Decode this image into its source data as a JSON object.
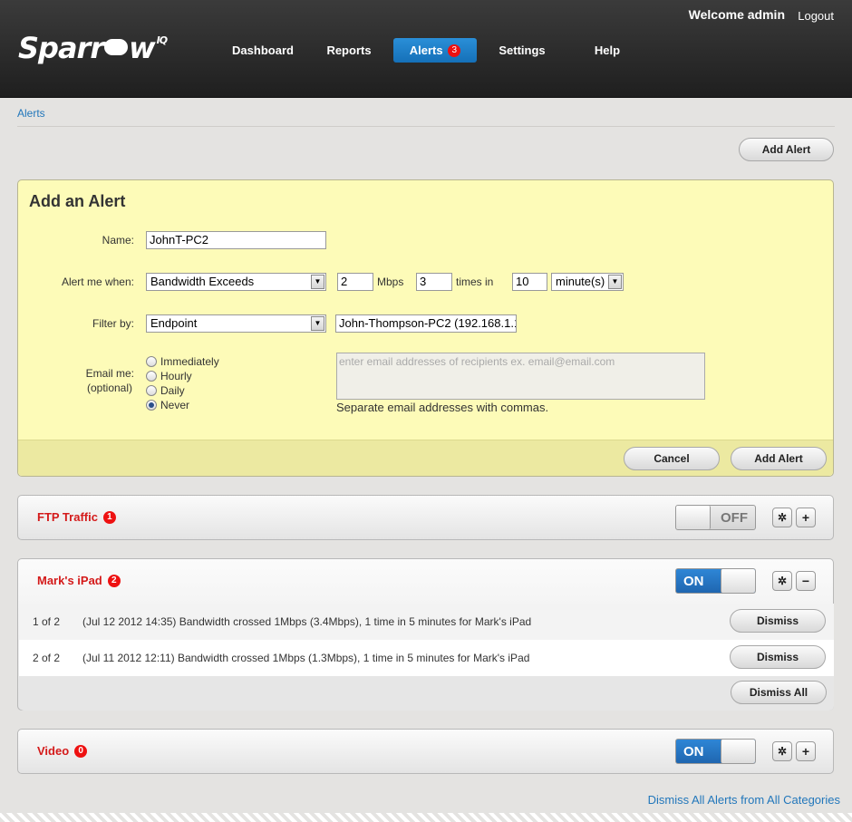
{
  "header": {
    "logo": {
      "pre": "Sparr",
      "post": "w",
      "superscript": "IQ"
    },
    "welcome": "Welcome admin",
    "logout": "Logout",
    "nav": [
      {
        "label": "Dashboard"
      },
      {
        "label": "Reports"
      },
      {
        "label": "Alerts",
        "badge": "3"
      },
      {
        "label": "Settings"
      },
      {
        "label": "Help"
      }
    ]
  },
  "breadcrumb": "Alerts",
  "top_button": "Add Alert",
  "form": {
    "title": "Add an Alert",
    "name_label": "Name:",
    "name_value": "JohnT-PC2",
    "alert_when_label": "Alert me when:",
    "condition": "Bandwidth Exceeds",
    "amount": "2",
    "unit": "Mbps",
    "times": "3",
    "times_in_label": "times in",
    "period": "10",
    "period_unit": "minute(s)",
    "filter_label": "Filter by:",
    "filter_type": "Endpoint",
    "filter_value": "John-Thompson-PC2 (192.168.1.1",
    "email_label": "Email me:",
    "email_label_2": "(optional)",
    "frequency_options": [
      "Immediately",
      "Hourly",
      "Daily",
      "Never"
    ],
    "frequency_selected": "Never",
    "email_placeholder": "enter email addresses of recipients ex. email@email.com",
    "email_hint": "Separate email addresses with commas.",
    "cancel": "Cancel",
    "submit": "Add Alert"
  },
  "categories": [
    {
      "title": "FTP Traffic",
      "count": "1",
      "toggle": "OFF"
    },
    {
      "title": "Mark's iPad",
      "count": "2",
      "toggle": "ON",
      "alerts": [
        {
          "index": "1 of 2",
          "message": "(Jul 12 2012 14:35) Bandwidth crossed 1Mbps (3.4Mbps), 1 time in 5 minutes for Mark's iPad",
          "action": "Dismiss"
        },
        {
          "index": "2 of 2",
          "message": "(Jul 11 2012 12:11) Bandwidth crossed 1Mbps (1.3Mbps), 1 time in 5 minutes for Mark's iPad",
          "action": "Dismiss"
        }
      ],
      "dismiss_all": "Dismiss All"
    },
    {
      "title": "Video",
      "count": "0",
      "toggle": "ON"
    }
  ],
  "dismiss_all_categories": "Dismiss All Alerts from All Categories",
  "icons": {
    "gear": "gear-icon",
    "plus": "plus-icon",
    "minus": "minus-icon",
    "dropdown": "chevron-down-icon"
  },
  "colors": {
    "accent": "#1f74c4",
    "alert_red": "#d41a1a",
    "form_bg": "#fdfbb8"
  }
}
